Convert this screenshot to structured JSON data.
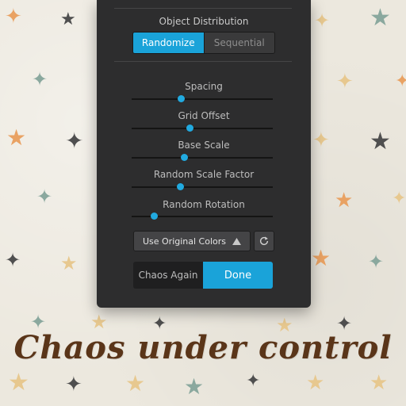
{
  "panel": {
    "object_distribution": {
      "label": "Object Distribution",
      "options": [
        "Randomize",
        "Sequential"
      ],
      "selected": "Randomize"
    },
    "sliders": [
      {
        "label": "Spacing",
        "value": 0.35
      },
      {
        "label": "Grid Offset",
        "value": 0.41
      },
      {
        "label": "Base Scale",
        "value": 0.37
      },
      {
        "label": "Random Scale Factor",
        "value": 0.34
      },
      {
        "label": "Random Rotation",
        "value": 0.16
      }
    ],
    "color_mode": {
      "label": "Use Original Colors",
      "icon": "triangle-up-icon"
    },
    "reset_icon": "refresh-icon",
    "buttons": {
      "secondary": "Chaos Again",
      "primary": "Done"
    }
  },
  "tagline": "Chaos under control",
  "colors": {
    "accent": "#1aa3d9",
    "panel": "#2d2d2e",
    "tagline": "#5a3519",
    "star_orange": "#e9a263",
    "star_gray": "#4f4f4f",
    "star_green": "#8aa89e",
    "star_tan": "#e7c88f"
  }
}
